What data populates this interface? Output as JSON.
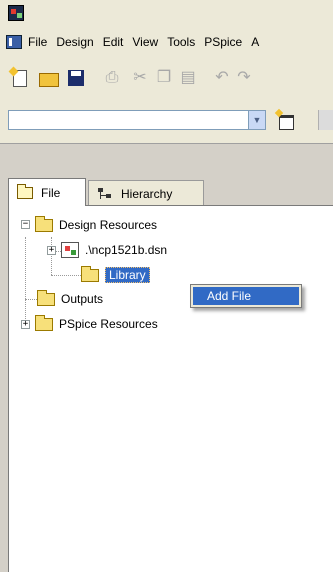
{
  "menubar": {
    "items": [
      {
        "label": "File"
      },
      {
        "label": "Design"
      },
      {
        "label": "Edit"
      },
      {
        "label": "View"
      },
      {
        "label": "Tools"
      },
      {
        "label": "PSpice"
      },
      {
        "label": "A"
      }
    ]
  },
  "toolbar": {
    "icons": [
      "new-document-icon",
      "open-folder-icon",
      "save-disk-icon",
      "print-icon",
      "cut-icon",
      "copy-icon",
      "paste-icon",
      "undo-icon",
      "redo-icon"
    ]
  },
  "toolbar2": {
    "combo_value": ""
  },
  "tabs": {
    "file_label": "File",
    "hierarchy_label": "Hierarchy"
  },
  "tree": {
    "root": {
      "label": "Design Resources",
      "expander": "−"
    },
    "design_file": {
      "label": ".\\ncp1521b.dsn",
      "expander": "+"
    },
    "library": {
      "label": "Library"
    },
    "outputs": {
      "label": "Outputs"
    },
    "pspice": {
      "label": "PSpice Resources",
      "expander": "+"
    }
  },
  "context_menu": {
    "items": [
      {
        "label": "Add File"
      }
    ]
  },
  "colors": {
    "selection": "#316ac5",
    "chrome": "#ece9d8",
    "folder": "#f7e07a"
  }
}
